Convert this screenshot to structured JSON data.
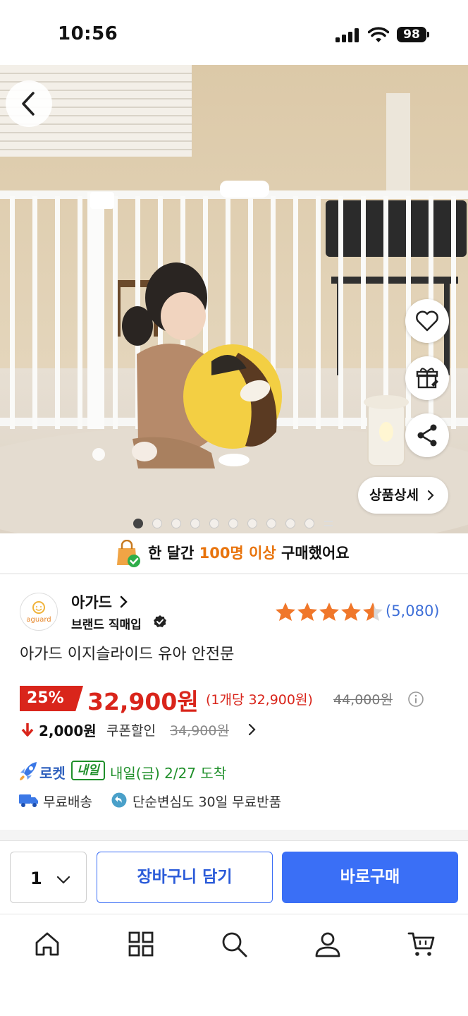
{
  "status_bar": {
    "time": "10:56",
    "battery": "98"
  },
  "hero": {
    "detail_button": "상품상세",
    "page_count": 10,
    "active_page": 1
  },
  "banner": {
    "pre": "한 달간 ",
    "highlight": "100명 이상",
    "post": " 구매했어요"
  },
  "brand": {
    "name": "아가드",
    "sub": "브랜드 직매입",
    "logo_text": "aguard"
  },
  "rating": {
    "value": 4.5,
    "max": 5,
    "reviews": "(5,080)"
  },
  "product": {
    "title": "아가드 이지슬라이드 유아 안전문"
  },
  "price": {
    "discount": "25%",
    "price": "32,900원",
    "unit_price": "(1개당 32,900원)",
    "original": "44,000원",
    "coupon_amount": "2,000원",
    "coupon_label": "쿠폰할인",
    "coupon_original": "34,900원"
  },
  "delivery": {
    "rocket": "로켓",
    "badge": "내일",
    "arrival": "내일(금) 2/27 도착",
    "free_shipping": "무료배송",
    "free_return": "단순변심도 30일 무료반품"
  },
  "purchase_bar": {
    "quantity": "1",
    "cart": "장바구니 담기",
    "buy_now": "바로구매"
  },
  "colors": {
    "accent_blue": "#3a6ff6",
    "price_red": "#d9251b",
    "star": "#f0772a",
    "rocket_green": "#1f8f2a"
  },
  "tab_bar": [
    "home-icon",
    "grid-icon",
    "search-icon",
    "user-icon",
    "cart-icon"
  ]
}
